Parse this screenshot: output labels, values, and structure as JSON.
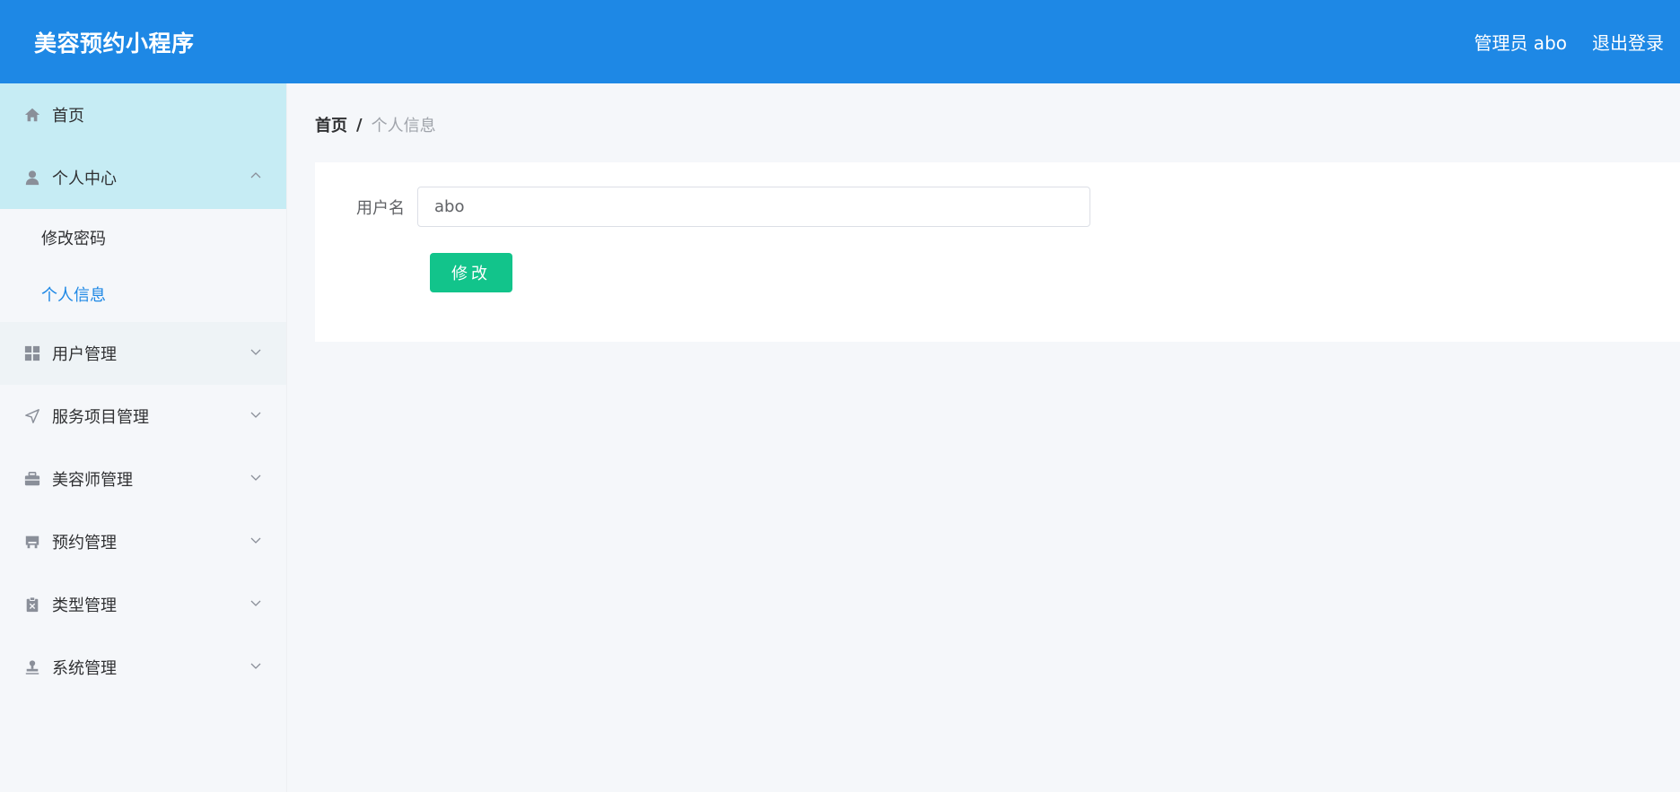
{
  "header": {
    "brand": "美容预约小程序",
    "admin_label": "管理员 abo",
    "logout_label": "退出登录"
  },
  "sidebar": {
    "items": [
      {
        "label": "首页",
        "icon": "home-icon"
      },
      {
        "label": "个人中心",
        "icon": "user-icon",
        "expanded": true,
        "children": [
          {
            "label": "修改密码"
          },
          {
            "label": "个人信息",
            "selected": true
          }
        ]
      },
      {
        "label": "用户管理",
        "icon": "grid-icon"
      },
      {
        "label": "服务项目管理",
        "icon": "navigation-icon"
      },
      {
        "label": "美容师管理",
        "icon": "briefcase-icon"
      },
      {
        "label": "预约管理",
        "icon": "shop-icon"
      },
      {
        "label": "类型管理",
        "icon": "clipboard-x-icon"
      },
      {
        "label": "系统管理",
        "icon": "stamp-icon"
      }
    ]
  },
  "breadcrumb": {
    "home": "首页",
    "separator": "/",
    "current": "个人信息"
  },
  "form": {
    "username_label": "用户名",
    "username_value": "abo",
    "submit_label": "修改"
  },
  "colors": {
    "header_bg": "#1e88e5",
    "active_menu_bg": "#c6ecf4",
    "submit_bg": "#12c48b",
    "selected_text": "#1e88e5"
  }
}
